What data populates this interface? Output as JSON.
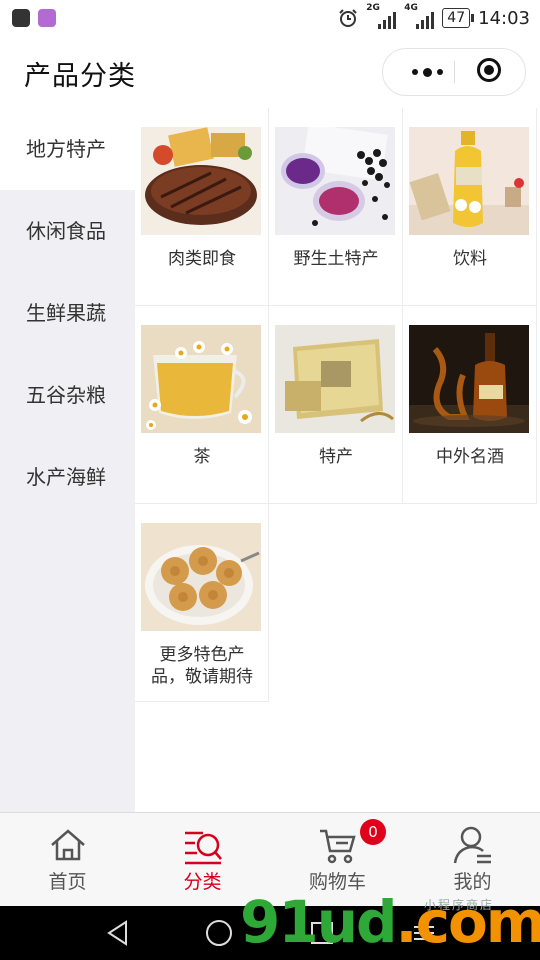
{
  "status": {
    "time": "14:03",
    "battery": "47",
    "net1": "2G",
    "net2": "4G"
  },
  "header": {
    "title": "产品分类"
  },
  "sidebar": {
    "items": [
      {
        "label": "地方特产",
        "active": true
      },
      {
        "label": "休闲食品",
        "active": false
      },
      {
        "label": "生鲜果蔬",
        "active": false
      },
      {
        "label": "五谷杂粮",
        "active": false
      },
      {
        "label": "水产海鲜",
        "active": false
      }
    ]
  },
  "products": [
    {
      "name": "肉类即食",
      "image": "steak-photo"
    },
    {
      "name": "野生土特产",
      "image": "wild-berries-photo"
    },
    {
      "name": "饮料",
      "image": "drink-bottle-photo"
    },
    {
      "name": "茶",
      "image": "chamomile-tea-photo"
    },
    {
      "name": "特产",
      "image": "gift-box-photo"
    },
    {
      "name": "中外名酒",
      "image": "liquor-bottle-photo"
    },
    {
      "name": "更多特色产品，敬请期待",
      "image": "cookies-photo"
    }
  ],
  "tabbar": {
    "tabs": [
      {
        "label": "首页",
        "icon": "home-icon",
        "active": false
      },
      {
        "label": "分类",
        "icon": "category-icon",
        "active": true
      },
      {
        "label": "购物车",
        "icon": "cart-icon",
        "active": false,
        "badge": "0"
      },
      {
        "label": "我的",
        "icon": "profile-icon",
        "active": false
      }
    ]
  },
  "watermark": {
    "text": "91ud",
    "suffix": ".com",
    "sub": "小程序商店"
  },
  "colors": {
    "accent": "#d6001c",
    "badge": "#e0001b",
    "sidebar_bg": "#f0f0f4"
  }
}
